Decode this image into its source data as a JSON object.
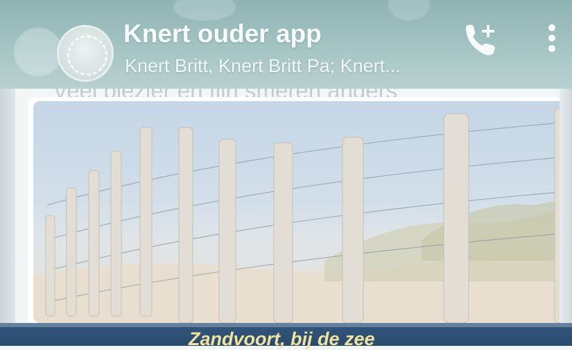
{
  "chat": {
    "title": "Knert ouder app",
    "subtitle": "Knert Britt, Knert Britt Pa; Knert..."
  },
  "messages": {
    "previous_text": "Veel plezier en fijn smeren anders",
    "image_caption": "Zandvoort, bij de zee"
  },
  "icons": {
    "avatar": "group-avatar",
    "call": "add-call-icon",
    "menu": "more-vert-icon"
  },
  "colors": {
    "header": "#a5c4c4",
    "header_text": "#f7fbfb",
    "caption": "#f2e2a2",
    "bottom_bar": "#2a4a6c"
  }
}
